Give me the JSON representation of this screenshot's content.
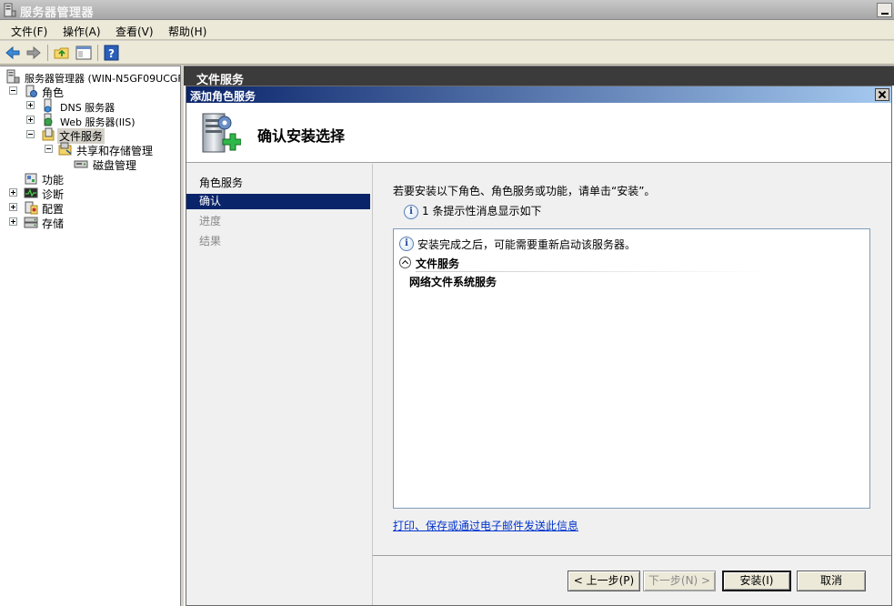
{
  "window": {
    "title": "服务器管理器"
  },
  "menu": [
    "文件(F)",
    "操作(A)",
    "查看(V)",
    "帮助(H)"
  ],
  "tree": {
    "root": "服务器管理器 (WIN-N5GF09UCGF",
    "roles": "角色",
    "dns": "DNS 服务器",
    "web": "Web 服务器(IIS)",
    "file_services": "文件服务",
    "share_storage": "共享和存储管理",
    "disk_mgmt": "磁盘管理",
    "features": "功能",
    "diagnostics": "诊断",
    "configuration": "配置",
    "storage": "存储"
  },
  "right_pane": {
    "header": "文件服务"
  },
  "dialog": {
    "title": "添加角色服务",
    "heading": "确认安装选择",
    "nav": [
      {
        "label": "角色服务",
        "state": "normal"
      },
      {
        "label": "确认",
        "state": "current"
      },
      {
        "label": "进度",
        "state": "dim"
      },
      {
        "label": "结果",
        "state": "dim"
      }
    ],
    "intro": "若要安装以下角色、角色服务或功能，请单击“安装”。",
    "note": "1 条提示性消息显示如下",
    "info_message": "安装完成之后，可能需要重新启动该服务器。",
    "section_title": "文件服务",
    "section_item": "网络文件系统服务",
    "link": "打印、保存或通过电子邮件发送此信息",
    "buttons": {
      "back": "< 上一步(P)",
      "next": "下一步(N) >",
      "install": "安装(I)",
      "cancel": "取消"
    }
  },
  "colors": {
    "selection": "#0a246a",
    "link": "#0033cc",
    "pane_header": "#3b3b3b"
  }
}
